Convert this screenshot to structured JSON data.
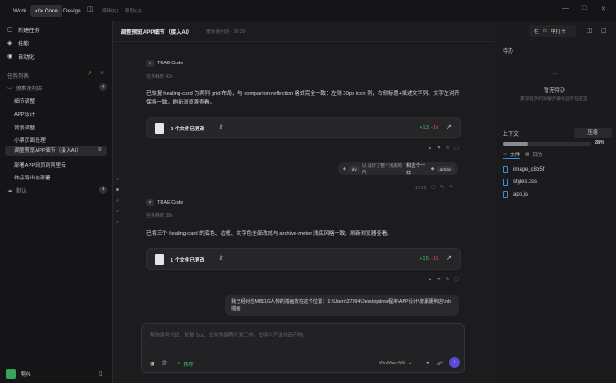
{
  "topbar": {
    "modes": [
      "Work",
      "</> Code",
      "Design"
    ],
    "menus": [
      "编辑(E)",
      "帮助(H)"
    ]
  },
  "sidebar": {
    "nav": [
      {
        "icon": "chat-icon",
        "label": "新建任务"
      },
      {
        "icon": "skill-icon",
        "label": "技能"
      },
      {
        "icon": "robot-icon",
        "label": "自动化"
      }
    ],
    "section_label": "任务列表",
    "project": "傻素便利店",
    "items": [
      "细节调整",
      "APP设计",
      "背景调整",
      "小票页面处理",
      "调整预览APP细节（接入AI）",
      "部署APP网页到阿里云",
      "作品导出与部署"
    ],
    "active_index": 4,
    "group2": "默认",
    "user": "啊伟"
  },
  "main": {
    "title": "调整预览APP细节（接入AI）",
    "subtitle": "傻素便利店 · 20:29",
    "brand": "TRAE Code",
    "msg1": {
      "time": "任务耗时 42s",
      "text": "已恢复 healing-card 为两列 grid 布局，与 companion-reflection 格式完全一致：左侧 30px icon 列，右侧标题+描述文字列。文字左对齐保持一致。刷新浏览器查看。",
      "files": "2 个文件已更改",
      "add": "+13",
      "del": "-16"
    },
    "user1": {
      "tag1": "div",
      "tag1_text": "以 设计了整个浅底的内",
      "mid": "和这个一样",
      "tag2": "article",
      "time": "17:12"
    },
    "msg2": {
      "time": "任务耗时 38s",
      "text": "已将三个 healing-card 的底色、边框、文字色全部改成与 archive-meter 浅底风格一致。刷新浏览器查看。",
      "files": "1 个文件已更改",
      "add": "+15",
      "del": "-15"
    },
    "user2": {
      "text": "我已经对应MB11G人物的插画放在这个位置：C:\\Users\\37994\\Desktop\\trea程序\\APP设计\\傻素便利店\\mb插画"
    },
    "input": {
      "placeholder": "帮你编写代码、修复 Bug、优化性能等开发工作。支持生产级代码产物。",
      "mode_label": "推荐",
      "model": "MiniMax-M3"
    }
  },
  "right": {
    "open_in": "在",
    "open_btn": "中打开",
    "todo_title": "待办",
    "empty_title": "暂无待办",
    "empty_desc": "复杂任务的拆解步骤会显示在这里",
    "context_title": "上下文",
    "compress": "压缩",
    "progress_text": "28%",
    "progress": 0.28,
    "tabs": [
      "文件",
      "其他"
    ],
    "files": [
      "image_c8b5f",
      "styles.css",
      "app.js"
    ]
  }
}
